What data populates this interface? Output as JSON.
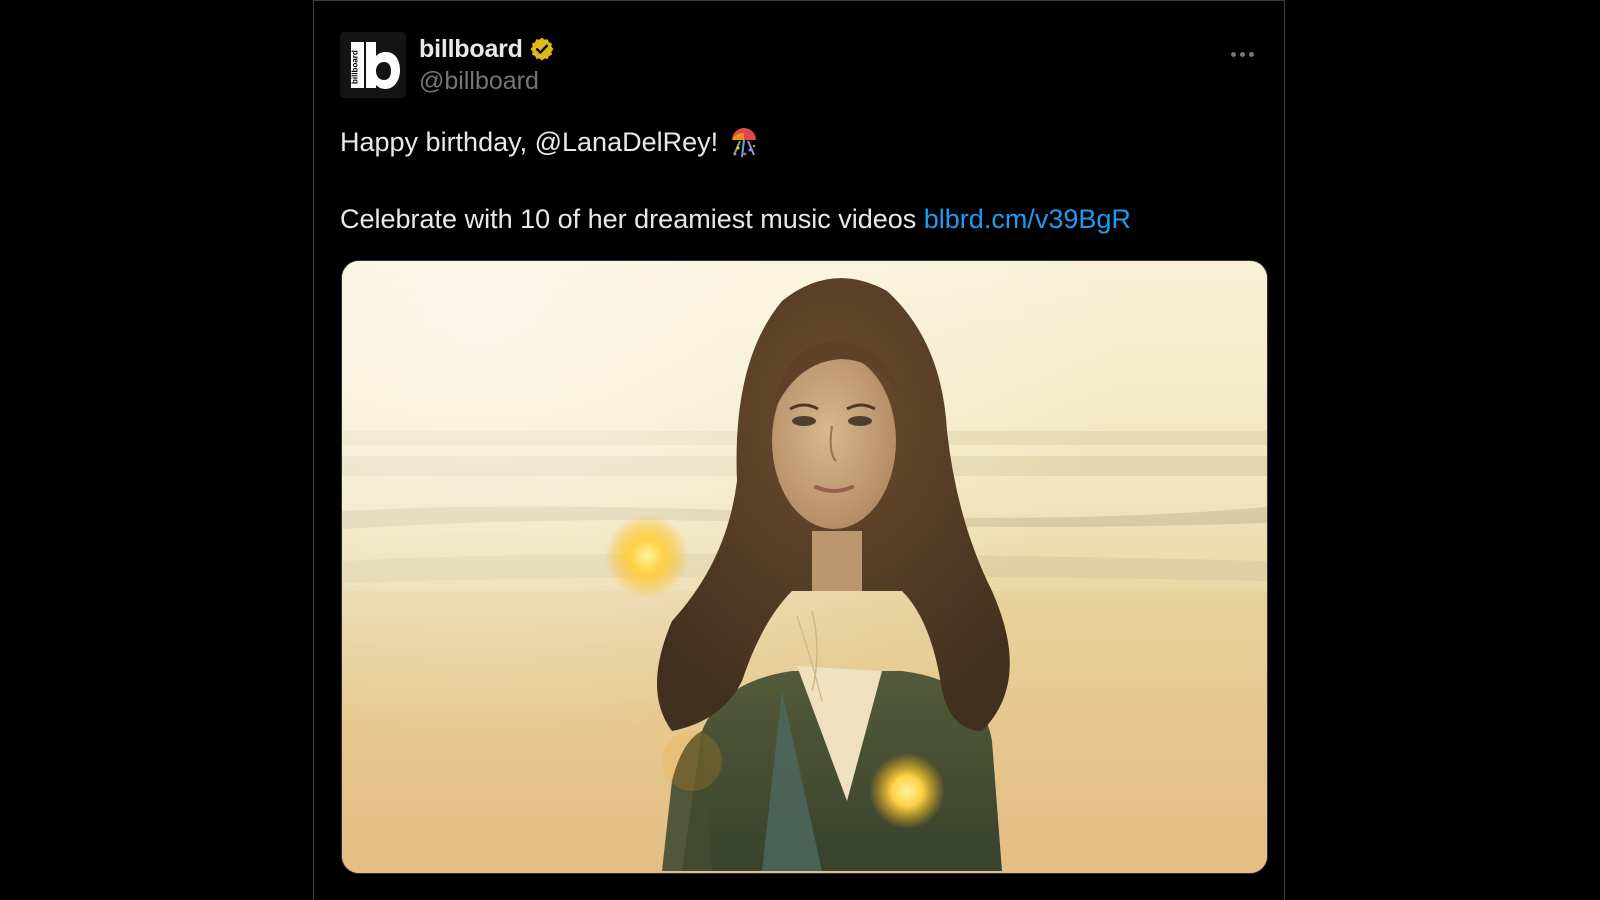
{
  "account": {
    "display_name": "billboard",
    "handle": "@billboard",
    "avatar_logo_text": "billboard",
    "verified": true
  },
  "tweet": {
    "greeting_prefix": "Happy birthday, ",
    "mention": "@LanaDelRey",
    "greeting_suffix": "!",
    "body_text": "Celebrate with 10 of her dreamiest music videos ",
    "link_text": "blbrd.cm/v39BgR",
    "emoji": "confetti-ball-icon"
  },
  "media": {
    "alt": "Portrait photo of a woman with long brown hair on a hazy beach at sunset"
  },
  "colors": {
    "background": "#000000",
    "text": "#e7e9ea",
    "secondary_text": "#71767b",
    "link": "#1d9bf0",
    "verified_badge": "#e2b719"
  },
  "icons": {
    "more": "more-options-icon",
    "verified": "verified-badge-icon"
  }
}
